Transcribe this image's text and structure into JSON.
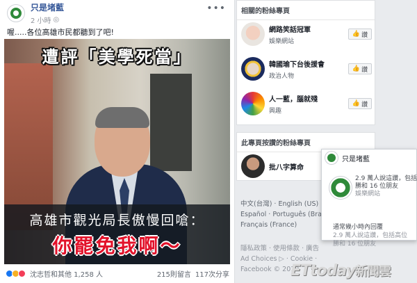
{
  "post": {
    "author": "只是堵藍",
    "time": "2 小時",
    "globe_symbol": "◎",
    "more_symbol": "•••",
    "text": "喔.....各位高雄市民都聽到了吧!",
    "video": {
      "caption_top": "遭評「美學死當」",
      "caption_mid": "高雄市觀光局長傲慢回嗆：",
      "caption_red": "你罷免我啊～"
    },
    "reactions_names": "沈志哲和其他 1,258 人",
    "comments": "215則留言",
    "shares": "117次分享"
  },
  "related": {
    "title": "相關的粉絲專頁",
    "items": [
      {
        "name": "網路笑話冠軍",
        "category": "娛樂網站",
        "like": "讚"
      },
      {
        "name": "韓國瑜下台後援會",
        "category": "政治人物",
        "like": "讚"
      },
      {
        "name": "人一藍，腦就殘",
        "category": "興趣",
        "like": "讚"
      }
    ],
    "like_icon": "👍"
  },
  "liked_by": {
    "title": "此專頁按讚的粉絲專頁",
    "items": [
      {
        "name": "批八字算命"
      }
    ]
  },
  "languages": {
    "line1": "中文(台灣) · English (US) ·",
    "line2": "Español · Português (Bra",
    "line3": "Français (France)"
  },
  "legal": {
    "line1": "隱私政策 · 使用條款 · 廣告",
    "line2": "Ad Choices ▷ · Cookie ·",
    "line3": "Facebook © 2019"
  },
  "popup": {
    "name": "只是堵藍",
    "line1": "2.9 萬人說這讚，包括",
    "line2": "勝和 16 位朋友",
    "line3": "娛樂網站",
    "row1": "通常幾小時內回覆",
    "row2": "2.9 萬人說這讚，包括高位",
    "row3": "勝和 16 位朋友"
  },
  "watermark": {
    "brand": "ETtoday",
    "sub": "新聞雲"
  }
}
